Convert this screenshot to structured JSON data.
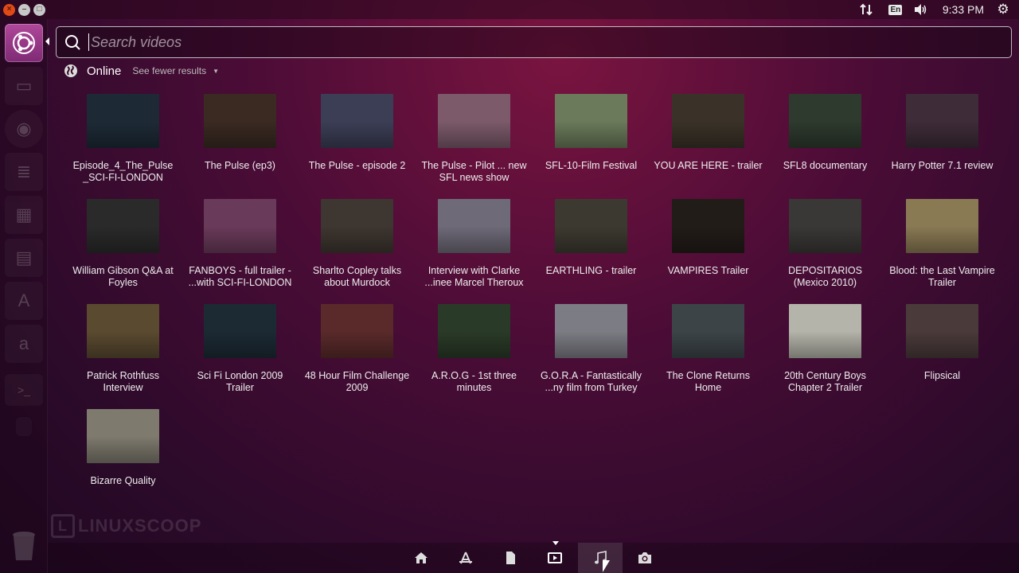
{
  "top_panel": {
    "window_buttons": [
      "close-icon",
      "minimize-icon",
      "maximize-icon"
    ],
    "keyboard_layout": "En",
    "clock": "9:33 PM",
    "indicators": [
      "network-icon",
      "keyboard-icon",
      "volume-icon",
      "gear-icon"
    ]
  },
  "launcher": {
    "items": [
      {
        "name": "ubuntu-logo-icon",
        "active": true
      },
      {
        "name": "files-icon"
      },
      {
        "name": "browser-icon"
      },
      {
        "name": "writer-icon"
      },
      {
        "name": "calc-icon"
      },
      {
        "name": "impress-icon"
      },
      {
        "name": "software-center-icon"
      },
      {
        "name": "amazon-icon",
        "glyph": "a"
      },
      {
        "name": "terminal-icon",
        "glyph": ">_"
      },
      {
        "name": "app-icon"
      }
    ]
  },
  "search": {
    "placeholder": "Search videos",
    "value": ""
  },
  "category": {
    "title": "Online",
    "toggle_label": "See fewer results"
  },
  "results": [
    {
      "label": "Episode_4_The_Pulse _SCI-FI-LONDON",
      "color": "#1d2a36"
    },
    {
      "label": "The Pulse (ep3)",
      "color": "#3a2a22"
    },
    {
      "label": "The Pulse - episode 2",
      "color": "#3c3e56"
    },
    {
      "label": "The Pulse - Pilot ... new SFL news show",
      "color": "#7c5a6a"
    },
    {
      "label": "SFL-10-Film Festival",
      "color": "#6a7a5a"
    },
    {
      "label": "YOU ARE HERE - trailer",
      "color": "#3a3228"
    },
    {
      "label": "SFL8 documentary",
      "color": "#2e3a2e"
    },
    {
      "label": "Harry Potter 7.1 review",
      "color": "#3e2c38"
    },
    {
      "label": "William Gibson Q&A at Foyles",
      "color": "#2a2a2a"
    },
    {
      "label": "FANBOYS - full trailer - ...with SCI-FI-LONDON",
      "color": "#6a3a5a"
    },
    {
      "label": "Sharlto Copley talks about Murdock",
      "color": "#3e3630"
    },
    {
      "label": "Interview with Clarke ...inee Marcel Theroux",
      "color": "#6e6a78"
    },
    {
      "label": "EARTHLING - trailer",
      "color": "#3c3a30"
    },
    {
      "label": "VAMPIRES Trailer",
      "color": "#221c18"
    },
    {
      "label": "DEPOSITARIOS (Mexico 2010)",
      "color": "#3a3836"
    },
    {
      "label": "Blood: the Last Vampire Trailer",
      "color": "#8a7a54"
    },
    {
      "label": "Patrick Rothfuss Interview",
      "color": "#5a4a30"
    },
    {
      "label": "Sci Fi London 2009 Trailer",
      "color": "#1c2a34"
    },
    {
      "label": "48 Hour Film Challenge 2009",
      "color": "#5a2a2a"
    },
    {
      "label": "A.R.O.G - 1st three minutes",
      "color": "#2a3a28"
    },
    {
      "label": "G.O.R.A - Fantastically ...ny film from Turkey",
      "color": "#7c7c84"
    },
    {
      "label": "The Clone Returns Home",
      "color": "#3c4448"
    },
    {
      "label": "20th Century Boys Chapter 2 Trailer",
      "color": "#b4b4aa"
    },
    {
      "label": "Flipsical",
      "color": "#4a3a3a"
    },
    {
      "label": "Bizarre Quality",
      "color": "#7e7a6e"
    }
  ],
  "watermark": "LINUXSCOOP",
  "lenses": [
    {
      "name": "home-lens-icon"
    },
    {
      "name": "apps-lens-icon"
    },
    {
      "name": "files-lens-icon"
    },
    {
      "name": "video-lens-icon",
      "selected": true
    },
    {
      "name": "music-lens-icon",
      "hovered": true
    },
    {
      "name": "photo-lens-icon"
    }
  ]
}
